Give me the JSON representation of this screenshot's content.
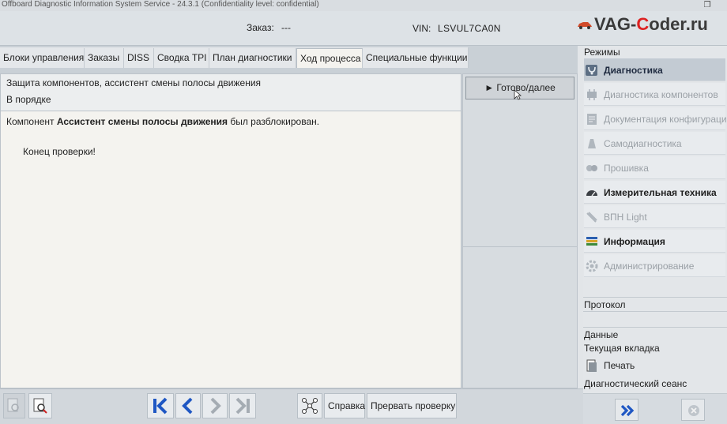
{
  "window": {
    "title": "Offboard Diagnostic Information System Service - 24.3.1 (Confidentiality level: confidential)",
    "restore_glyph": "❐"
  },
  "header": {
    "order_label": "Заказ:",
    "order_value": "---",
    "vin_label": "VIN:",
    "vin_value": "LSVUL7CA0N",
    "watermark_prefix": "VAG-",
    "watermark_c": "C",
    "watermark_suffix": "oder.ru"
  },
  "tabs": [
    {
      "label": "Блоки управления",
      "active": false
    },
    {
      "label": "Заказы",
      "active": false
    },
    {
      "label": "DISS",
      "active": false
    },
    {
      "label": "Сводка TPI",
      "active": false
    },
    {
      "label": "План диагностики",
      "active": false
    },
    {
      "label": "Ход процесса",
      "active": true
    },
    {
      "label": "Специальные функции",
      "active": false
    }
  ],
  "info": {
    "line1": "Защита компонентов, ассистент смены полосы движения",
    "line2": "В порядке"
  },
  "main": {
    "msg_prefix": "Компонент ",
    "msg_bold": "Ассистент смены полосы движения",
    "msg_suffix": " был разблокирован.",
    "end": "Конец проверки!"
  },
  "actions": {
    "next_label": "► Готово/далее"
  },
  "sidebar": {
    "modes_header": "Режимы",
    "items": [
      {
        "label": "Диагностика",
        "state": "active",
        "icon": "stethoscope-icon"
      },
      {
        "label": "Диагностика компонентов",
        "state": "disabled",
        "icon": "component-icon"
      },
      {
        "label": "Документация конфигурации",
        "state": "disabled",
        "icon": "config-doc-icon"
      },
      {
        "label": "Самодиагностика",
        "state": "disabled",
        "icon": "self-diagnosis-icon"
      },
      {
        "label": "Прошивка",
        "state": "disabled",
        "icon": "flash-icon"
      },
      {
        "label": "Измерительная техника",
        "state": "bold",
        "icon": "gauge-icon"
      },
      {
        "label": "ВПН Light",
        "state": "disabled",
        "icon": "vpn-icon"
      },
      {
        "label": "Информация",
        "state": "bold",
        "icon": "books-icon"
      },
      {
        "label": "Администрирование",
        "state": "disabled",
        "icon": "gear-icon"
      }
    ],
    "protocol_header": "Протокол",
    "data_header": "Данные",
    "current_tab_header": "Текущая вкладка",
    "print_label": "Печать",
    "session_header": "Диагностический сеанс"
  },
  "bottom": {
    "help_label": "Справка",
    "abort_label": "Прервать проверку"
  },
  "colors": {
    "nav_blue": "#1f57c3",
    "nav_disabled": "#a5acb3",
    "accent_red": "#d22222"
  }
}
